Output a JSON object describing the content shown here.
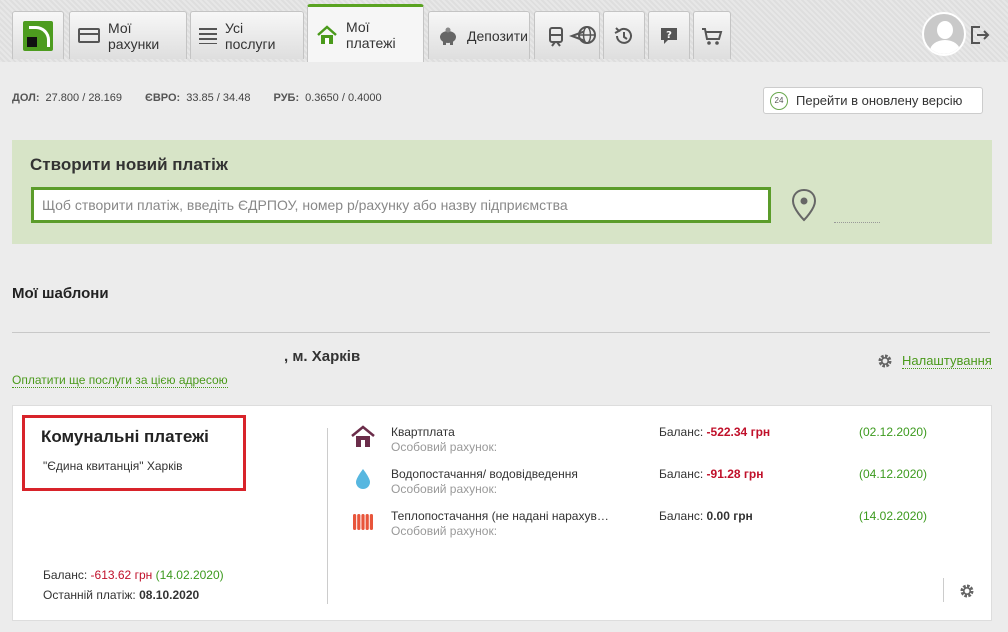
{
  "nav": {
    "tabs": [
      {
        "label": "Мої рахунки"
      },
      {
        "label": "Усі послуги"
      },
      {
        "label": "Мої платежі"
      },
      {
        "label": "Депозити"
      }
    ],
    "icons": [
      "transport-icon",
      "globe-icon",
      "history-icon",
      "help-icon",
      "cart-icon"
    ]
  },
  "rates": {
    "usd_label": "ДОЛ:",
    "usd": "27.800 / 28.169",
    "eur_label": "ЄВРО:",
    "eur": "33.85 / 34.48",
    "rub_label": "РУБ:",
    "rub": "0.3650 / 0.4000"
  },
  "new_version": {
    "badge": "24",
    "label": "Перейти в оновлену версію"
  },
  "create": {
    "title": "Створити новий платіж",
    "placeholder": "Щоб створити платіж, введіть ЄДРПОУ, номер р/рахунку або назву підприємства"
  },
  "templates": {
    "title": "Мої шаблони",
    "address": ", м. Харків",
    "pay_more": "Оплатити ще послуги за цією адресою",
    "settings": "Налаштування"
  },
  "card": {
    "title": "Комунальні платежі",
    "subtitle": "\"Єдина квитанція\" Харків",
    "balance_label": "Баланс:",
    "balance": "-613.62 грн",
    "balance_date": "(14.02.2020)",
    "last_label": "Останній платіж:",
    "last_date": "08.10.2020"
  },
  "services": [
    {
      "icon": "house-icon",
      "name": "Квартплата",
      "account": "Особовий рахунок:",
      "balance_label": "Баланс:",
      "balance": "-522.34 грн",
      "date": "(02.12.2020)",
      "negative": true
    },
    {
      "icon": "water-drop-icon",
      "name": "Водопостачання/ водовідведення",
      "account": "Особовий рахунок:",
      "balance_label": "Баланс:",
      "balance": "-91.28 грн",
      "date": "(04.12.2020)",
      "negative": true
    },
    {
      "icon": "radiator-icon",
      "name": "Теплопостачання (не надані нарахув…",
      "account": "Особовий рахунок:",
      "balance_label": "Баланс:",
      "balance": "0.00 грн",
      "date": "(14.02.2020)",
      "negative": false
    }
  ],
  "colors": {
    "accent": "#5aa321",
    "negative": "#c0102a",
    "panel": "#d7e4c7",
    "highlight": "#d8232a"
  }
}
